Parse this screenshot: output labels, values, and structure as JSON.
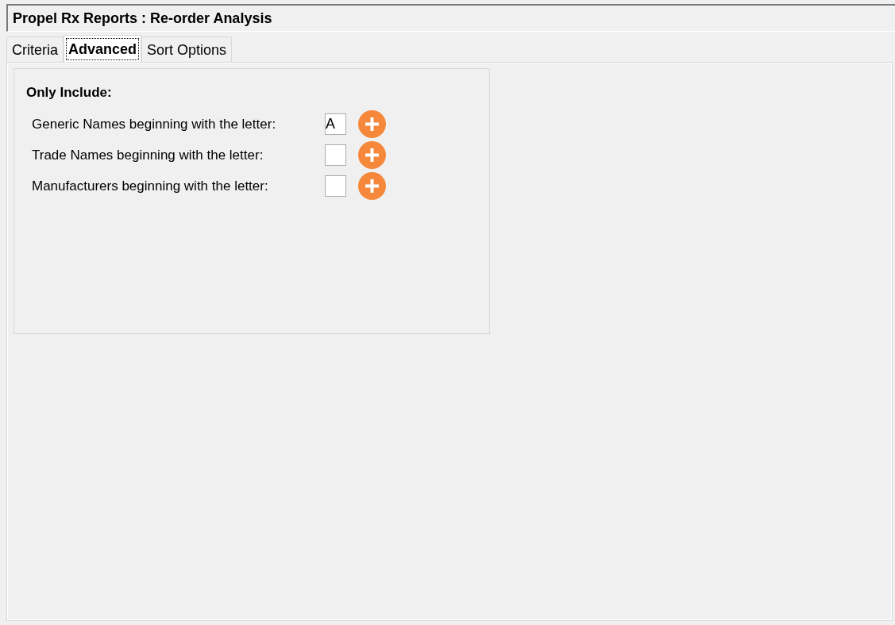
{
  "window": {
    "title": "Propel Rx Reports : Re-order Analysis"
  },
  "tabs": [
    {
      "label": "Criteria",
      "selected": false
    },
    {
      "label": "Advanced",
      "selected": true
    },
    {
      "label": "Sort Options",
      "selected": false
    }
  ],
  "only_include": {
    "heading": "Only Include:",
    "rows": [
      {
        "label": "Generic Names beginning with the letter:",
        "value": "A"
      },
      {
        "label": "Trade Names beginning with the letter:"
      },
      {
        "label": "Manufacturers beginning with the letter:"
      }
    ]
  }
}
